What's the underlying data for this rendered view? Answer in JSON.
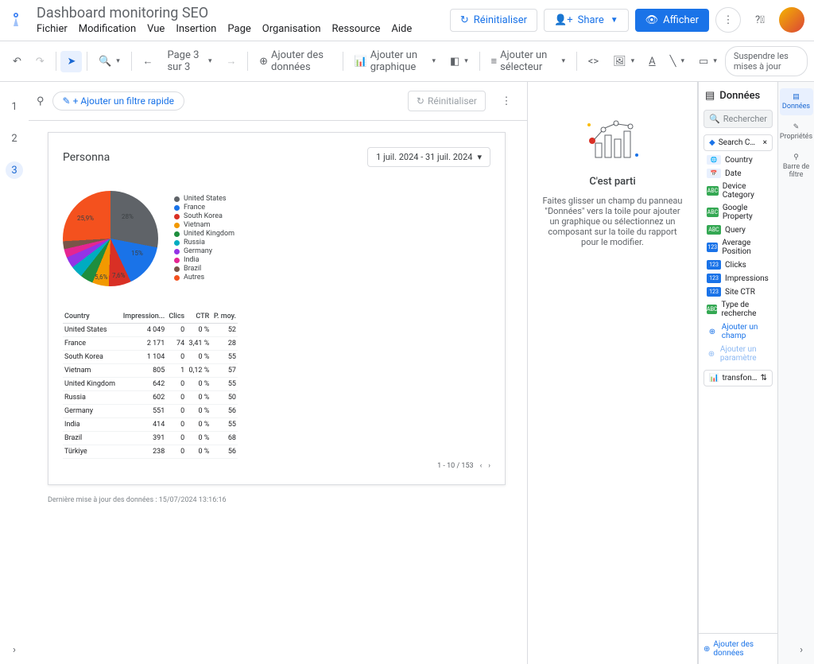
{
  "doc_title": "Dashboard monitoring SEO",
  "menus": [
    "Fichier",
    "Modification",
    "Vue",
    "Insertion",
    "Page",
    "Organisation",
    "Ressource",
    "Aide"
  ],
  "header": {
    "reset": "Réinitialiser",
    "share": "Share",
    "view": "Afficher"
  },
  "toolbar": {
    "page_indicator": "Page 3 sur 3",
    "add_data": "Ajouter des données",
    "add_chart": "Ajouter un graphique",
    "add_selector": "Ajouter un sélecteur",
    "suspend": "Suspendre les mises à jour"
  },
  "pages": [
    "1",
    "2",
    "3"
  ],
  "active_page": "3",
  "filter_bar": {
    "add_quick": "+ Ajouter un filtre rapide",
    "reset": "Réinitialiser"
  },
  "report": {
    "title": "Personna",
    "date_range": "1 juil. 2024 - 31 juil. 2024",
    "columns": [
      "Country",
      "Impression...",
      "Clics",
      "CTR",
      "P. moy."
    ],
    "rows": [
      {
        "country": "United States",
        "impr": "4 049",
        "clicks": "0",
        "ctr": "0 %",
        "pos": "52"
      },
      {
        "country": "France",
        "impr": "2 171",
        "clicks": "74",
        "ctr": "3,41 %",
        "pos": "28"
      },
      {
        "country": "South Korea",
        "impr": "1 104",
        "clicks": "0",
        "ctr": "0 %",
        "pos": "55"
      },
      {
        "country": "Vietnam",
        "impr": "805",
        "clicks": "1",
        "ctr": "0,12 %",
        "pos": "57"
      },
      {
        "country": "United Kingdom",
        "impr": "642",
        "clicks": "0",
        "ctr": "0 %",
        "pos": "55"
      },
      {
        "country": "Russia",
        "impr": "602",
        "clicks": "0",
        "ctr": "0 %",
        "pos": "50"
      },
      {
        "country": "Germany",
        "impr": "551",
        "clicks": "0",
        "ctr": "0 %",
        "pos": "56"
      },
      {
        "country": "India",
        "impr": "414",
        "clicks": "0",
        "ctr": "0 %",
        "pos": "55"
      },
      {
        "country": "Brazil",
        "impr": "391",
        "clicks": "0",
        "ctr": "0 %",
        "pos": "68"
      },
      {
        "country": "Türkiye",
        "impr": "238",
        "clicks": "0",
        "ctr": "0 %",
        "pos": "56"
      }
    ],
    "pager": "1 - 10 / 153",
    "legend": [
      {
        "label": "United States",
        "color": "#5f6368"
      },
      {
        "label": "France",
        "color": "#1a73e8"
      },
      {
        "label": "South Korea",
        "color": "#d93025"
      },
      {
        "label": "Vietnam",
        "color": "#f29900"
      },
      {
        "label": "United Kingdom",
        "color": "#1e8e3e"
      },
      {
        "label": "Russia",
        "color": "#00acc1"
      },
      {
        "label": "Germany",
        "color": "#9334e6"
      },
      {
        "label": "India",
        "color": "#e52592"
      },
      {
        "label": "Brazil",
        "color": "#795548"
      },
      {
        "label": "Autres",
        "color": "#f4511e"
      }
    ],
    "pie_labels": {
      "us": "28%",
      "fr": "15%",
      "sk": "7,6%",
      "vn": "5,6%",
      "other": "25,9%"
    }
  },
  "chart_data": {
    "type": "pie",
    "title": "Personna",
    "categories": [
      "United States",
      "France",
      "South Korea",
      "Vietnam",
      "United Kingdom",
      "Russia",
      "Germany",
      "India",
      "Brazil",
      "Autres"
    ],
    "values": [
      28,
      15,
      7.6,
      5.6,
      4.4,
      4.1,
      3.8,
      2.9,
      2.7,
      25.9
    ],
    "colors": [
      "#5f6368",
      "#1a73e8",
      "#d93025",
      "#f29900",
      "#1e8e3e",
      "#00acc1",
      "#9334e6",
      "#e52592",
      "#795548",
      "#f4511e"
    ]
  },
  "update_ts": "Dernière mise à jour des données : 15/07/2024 13:16:16",
  "intro": {
    "title": "C'est parti",
    "body": "Faites glisser un champ du panneau \"Données\" vers la toile pour ajouter un graphique ou sélectionnez un composant sur la toile du rapport pour le modifier."
  },
  "data_panel": {
    "title": "Données",
    "search": "Rechercher",
    "source": "Search Console htt...",
    "fields": [
      {
        "badge": "geo",
        "label": "Country"
      },
      {
        "badge": "date",
        "label": "Date"
      },
      {
        "badge": "abc",
        "label": "Device Category"
      },
      {
        "badge": "abc",
        "label": "Google Property"
      },
      {
        "badge": "abc",
        "label": "Query"
      },
      {
        "badge": "123",
        "label": "Average Position"
      },
      {
        "badge": "123",
        "label": "Clicks"
      },
      {
        "badge": "123",
        "label": "Impressions"
      },
      {
        "badge": "123",
        "label": "Site CTR"
      },
      {
        "badge": "abc",
        "label": "Type de recherche"
      }
    ],
    "add_field": "Ajouter un champ",
    "add_param": "Ajouter un paramètre",
    "blend": "transfonumerique...",
    "foot": "Ajouter des données"
  },
  "side_tabs": {
    "data": "Données",
    "props": "Propriétés",
    "filter": "Barre de filtre"
  }
}
